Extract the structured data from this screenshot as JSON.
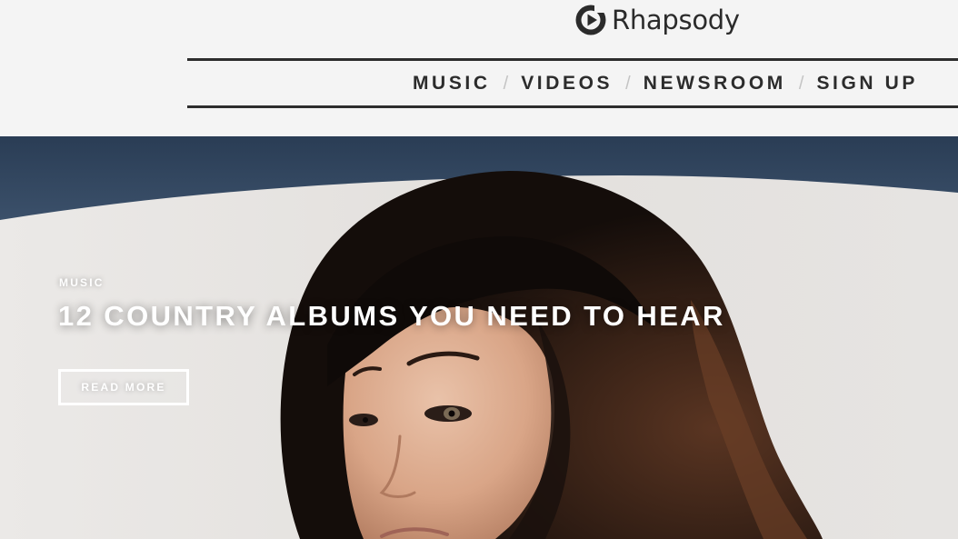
{
  "brand": {
    "name": "Rhapsody",
    "logo_icon": "rhapsody-play-logo-icon"
  },
  "nav": {
    "items": [
      {
        "label": "MUSIC"
      },
      {
        "label": "VIDEOS"
      },
      {
        "label": "NEWSROOM"
      },
      {
        "label": "SIGN UP"
      }
    ],
    "separator": "/"
  },
  "hero": {
    "category": "MUSIC",
    "headline": "12 COUNTRY ALBUMS YOU NEED TO HEAR",
    "cta_label": "READ MORE",
    "image": "portrait-photo"
  },
  "colors": {
    "header_bg": "#f4f4f4",
    "text_dark": "#2c2c2c",
    "rule": "#2d2d2d",
    "hero_text": "#ffffff",
    "ceiling_blue": "#30455f"
  }
}
